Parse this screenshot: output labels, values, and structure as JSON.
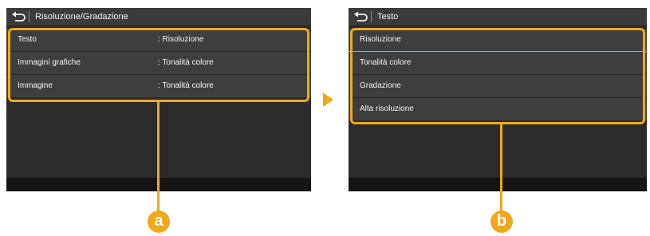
{
  "screen_a": {
    "title": "Risoluzione/Gradazione",
    "rows": [
      {
        "label": "Testo",
        "value": ": Risoluzione"
      },
      {
        "label": "Immagini grafiche",
        "value": ": Tonalità colore"
      },
      {
        "label": "Immagine",
        "value": ": Tonalità colore"
      }
    ]
  },
  "screen_b": {
    "title": "Testo",
    "options": [
      "Risoluzione",
      "Tonalità colore",
      "Gradazione",
      "Alta risoluzione"
    ]
  },
  "callouts": {
    "a": "a",
    "b": "b"
  },
  "colors": {
    "accent": "#f0a81e",
    "panel": "#2b2b2b",
    "row": "#3e3e3e"
  }
}
